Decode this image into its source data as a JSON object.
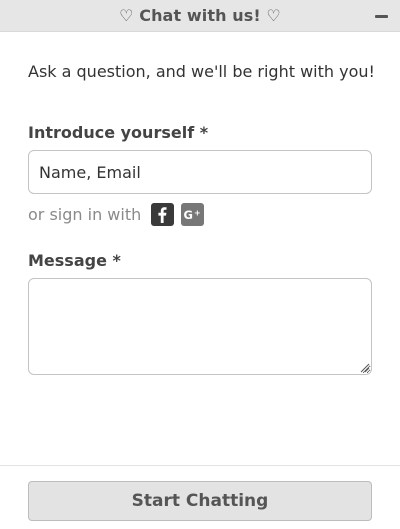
{
  "header": {
    "title": "♡ Chat with us! ♡",
    "minimize_icon": "minimize-icon"
  },
  "intro_text": "Ask a question, and we'll be right with you!",
  "introduce": {
    "label": "Introduce yourself *",
    "placeholder": "Name, Email",
    "value": ""
  },
  "signin": {
    "text": "or sign in with",
    "providers": [
      {
        "name": "Facebook",
        "icon": "facebook-icon",
        "color": "#3a3a3a"
      },
      {
        "name": "Google+",
        "icon": "google-plus-icon",
        "color": "#777777"
      }
    ]
  },
  "message": {
    "label": "Message *",
    "value": ""
  },
  "start_button": {
    "label": "Start Chatting"
  },
  "colors": {
    "header_bg": "#e6e6e6",
    "button_bg": "#e3e3e3",
    "text": "#333333",
    "muted": "#8a8a8a"
  }
}
